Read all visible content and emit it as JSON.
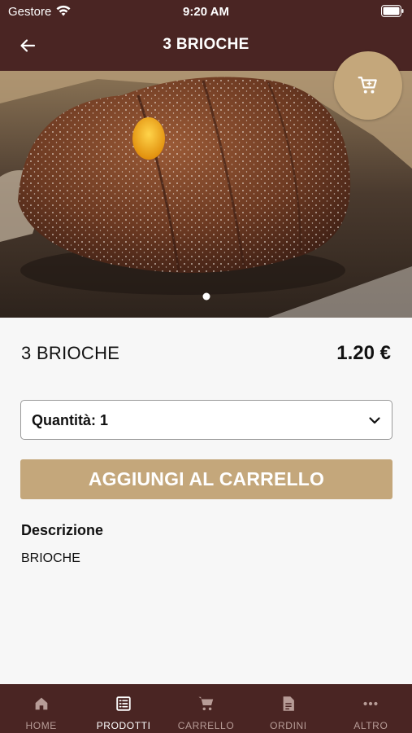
{
  "status_bar": {
    "carrier": "Gestore",
    "time": "9:20 AM"
  },
  "header": {
    "title": "3 BRIOCHE",
    "back_icon": "arrow-left-icon",
    "cart_icon": "cart-icon"
  },
  "gallery": {
    "image_count": 1,
    "active_index": 0
  },
  "product": {
    "name": "3 BRIOCHE",
    "price": "1.20 €",
    "quantity_label": "Quantità: 1",
    "add_to_cart_label": "AGGIUNGI AL CARRELLO",
    "description_title": "Descrizione",
    "description": "BRIOCHE"
  },
  "colors": {
    "brand_dark": "#4a2523",
    "accent": "#c4a77b"
  },
  "tabbar": {
    "items": [
      {
        "label": "HOME",
        "icon": "home-icon"
      },
      {
        "label": "PRODOTTI",
        "icon": "list-icon"
      },
      {
        "label": "CARRELLO",
        "icon": "cart-icon"
      },
      {
        "label": "ORDINI",
        "icon": "document-icon"
      },
      {
        "label": "ALTRO",
        "icon": "more-icon"
      }
    ],
    "active_index": 1
  }
}
